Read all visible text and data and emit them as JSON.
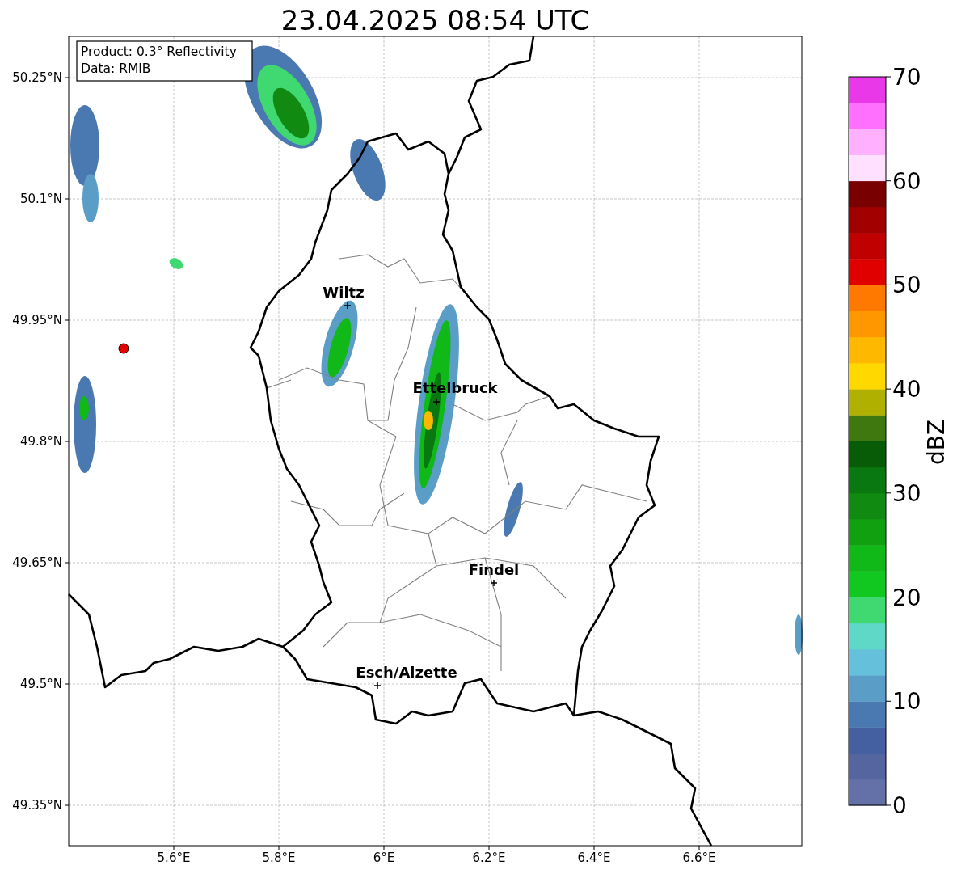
{
  "title": "23.04.2025 08:54 UTC",
  "info_box": [
    "Product: 0.3° Reflectivity",
    "Data: RMIB"
  ],
  "x_ticks": [
    "5.6°E",
    "5.8°E",
    "6°E",
    "6.2°E",
    "6.4°E",
    "6.6°E"
  ],
  "y_ticks": [
    "50.25°N",
    "50.1°N",
    "49.95°N",
    "49.8°N",
    "49.65°N",
    "49.5°N",
    "49.35°N"
  ],
  "cities": [
    {
      "name": "Wiltz"
    },
    {
      "name": "Ettelbruck"
    },
    {
      "name": "Findel"
    },
    {
      "name": "Esch/Alzette"
    }
  ],
  "colorbar": {
    "label": "dBZ",
    "ticks": [
      "70",
      "60",
      "50",
      "40",
      "30",
      "20",
      "10",
      "0"
    ],
    "bands": [
      {
        "color": "#6470a8"
      },
      {
        "color": "#55659f"
      },
      {
        "color": "#4560a0"
      },
      {
        "color": "#4a78b0"
      },
      {
        "color": "#5a9ec8"
      },
      {
        "color": "#65c0dc"
      },
      {
        "color": "#60d8c8"
      },
      {
        "color": "#40d870"
      },
      {
        "color": "#10c820"
      },
      {
        "color": "#10b818"
      },
      {
        "color": "#10a010"
      },
      {
        "color": "#108a10"
      },
      {
        "color": "#0a7810"
      },
      {
        "color": "#085c08"
      },
      {
        "color": "#407810"
      },
      {
        "color": "#b0b000"
      },
      {
        "color": "#ffd800"
      },
      {
        "color": "#ffb800"
      },
      {
        "color": "#ff9800"
      },
      {
        "color": "#ff7800"
      },
      {
        "color": "#e00000"
      },
      {
        "color": "#c00000"
      },
      {
        "color": "#a00000"
      },
      {
        "color": "#780000"
      },
      {
        "color": "#ffe0ff"
      },
      {
        "color": "#ffb0ff"
      },
      {
        "color": "#ff70ff"
      },
      {
        "color": "#e838e8"
      }
    ]
  }
}
